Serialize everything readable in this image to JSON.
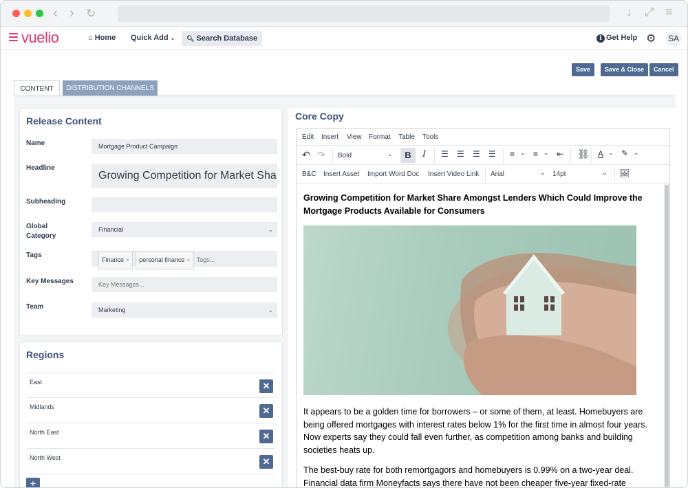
{
  "app": {
    "logo": "vuelio",
    "brand_color": "#e0336f",
    "accent_color": "#4e6a93"
  },
  "nav": {
    "home": "Home",
    "quick_add": "Quick Add",
    "search": "Search Database",
    "help": "Get Help",
    "avatar": "SA"
  },
  "actions": {
    "save": "Save",
    "save_close": "Save & Close",
    "cancel": "Cancel"
  },
  "tabs": [
    {
      "label": "CONTENT"
    },
    {
      "label": "DISTRIBUTION CHANNELS"
    }
  ],
  "release": {
    "title": "Release Content",
    "name_label": "Name",
    "name_value": "Mortgage Product Campaign",
    "headline_label": "Headline",
    "headline_value": "Growing Competition for Market Sha",
    "subheading_label": "Subheading",
    "subheading_value": "",
    "category_label_1": "Global",
    "category_label_2": "Category",
    "category_value": "Financial",
    "tags_label": "Tags",
    "tags": [
      "Finance",
      "personal finance"
    ],
    "tags_placeholder": "Tags...",
    "key_messages_label": "Key Messages",
    "key_messages_placeholder": "Key Messages...",
    "team_label": "Team",
    "team_value": "Marketing"
  },
  "regions": {
    "title": "Regions",
    "items": [
      "East",
      "Midlands",
      "North East",
      "North West"
    ]
  },
  "editor": {
    "title": "Core Copy",
    "menu": [
      "Edit",
      "Insert",
      "View",
      "Format",
      "Table",
      "Tools"
    ],
    "block_format": "Bold",
    "toolbar2": [
      "B&C",
      "Insert Asset",
      "Import Word Doc",
      "Insert Video Link"
    ],
    "font_family": "Arial",
    "font_size": "14pt",
    "doc_title": "Growing Competition for Market Share Amongst Lenders Which Could Improve the Mortgage Products Available for Consumers",
    "para1": "It appears to be a golden time for borrowers – or some of them, at least. Homebuyers are being offered mortgages with interest rates below 1% for the first time in almost four years. Now experts say they could fall even further, as competition among banks and building societies heats up.",
    "para2": "The best-buy rate for both remortgagors and homebuyers is 0.99% on a two-year deal. Financial data firm Moneyfacts says there have not been cheaper five-year fixed-rate"
  }
}
